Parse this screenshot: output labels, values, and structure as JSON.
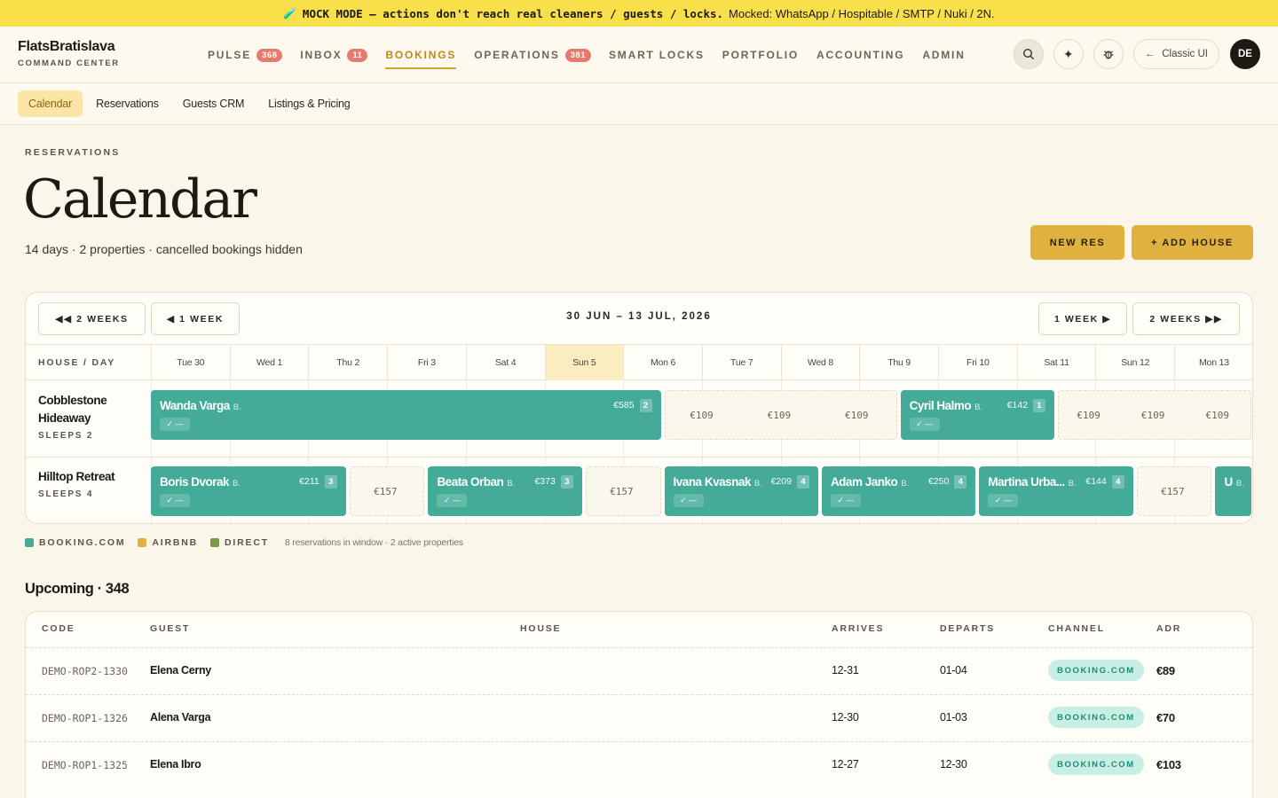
{
  "banner": {
    "icon": "test-tube-icon",
    "strong": "MOCK MODE — actions don't reach real cleaners / guests / locks.",
    "rest": "Mocked: WhatsApp / Hospitable / SMTP / Nuki / 2N."
  },
  "brand": {
    "name": "FlatsBratislava",
    "sub": "COMMAND CENTER"
  },
  "nav": [
    {
      "label": "PULSE",
      "count": "368"
    },
    {
      "label": "INBOX",
      "count": "11"
    },
    {
      "label": "BOOKINGS",
      "count": ""
    },
    {
      "label": "OPERATIONS",
      "count": "381"
    },
    {
      "label": "SMART LOCKS",
      "count": ""
    },
    {
      "label": "PORTFOLIO",
      "count": ""
    },
    {
      "label": "ACCOUNTING",
      "count": ""
    },
    {
      "label": "ADMIN",
      "count": ""
    }
  ],
  "nav_active": "BOOKINGS",
  "topright": {
    "classic_label": "Classic UI",
    "avatar": "DE"
  },
  "subnav": [
    "Calendar",
    "Reservations",
    "Guests CRM",
    "Listings & Pricing"
  ],
  "page": {
    "eyebrow": "RESERVATIONS",
    "title": "Calendar",
    "subtitle": "14 days · 2 properties · cancelled bookings hidden",
    "new_res": "NEW RES",
    "add_house": "+ ADD HOUSE"
  },
  "calendar": {
    "prev2": "◀◀ 2 WEEKS",
    "prev1": "◀ 1 WEEK",
    "range": "30 JUN – 13 JUL, 2026",
    "next1": "1 WEEK ▶",
    "next2": "2 WEEKS ▶▶",
    "house_day": "HOUSE / DAY",
    "days": [
      "Tue 30",
      "Wed 1",
      "Thu 2",
      "Fri 3",
      "Sat 4",
      "Sun 5",
      "Mon 6",
      "Tue 7",
      "Wed 8",
      "Thu 9",
      "Fri 10",
      "Sat 11",
      "Sun 12",
      "Mon 13"
    ],
    "today_index": 5,
    "houses": [
      {
        "name": "Cobblestone Hideaway",
        "sleeps": "SLEEPS 2",
        "bookings": [
          {
            "guest": "Wanda Varga",
            "ch": "B.",
            "price": "€585",
            "nights": "2",
            "start": 0,
            "end": 6.5
          },
          {
            "guest": "Cyril Halmo",
            "ch": "B.",
            "price": "€142",
            "nights": "1",
            "start": 9.5,
            "end": 11.5
          }
        ],
        "slots": [
          {
            "start": 6.5,
            "end": 9.5,
            "prices": [
              "€109",
              "€109",
              "€109"
            ]
          },
          {
            "start": 11.5,
            "end": 14,
            "prices": [
              "€109",
              "€109",
              "€109"
            ]
          }
        ]
      },
      {
        "name": "Hilltop Retreat",
        "sleeps": "SLEEPS 4",
        "bookings": [
          {
            "guest": "Boris Dvorak",
            "ch": "B.",
            "price": "€211",
            "nights": "3",
            "start": 0,
            "end": 2.5
          },
          {
            "guest": "Beata Orban",
            "ch": "B.",
            "price": "€373",
            "nights": "3",
            "start": 3.5,
            "end": 5.5
          },
          {
            "guest": "Ivana Kvasnak",
            "ch": "B.",
            "price": "€209",
            "nights": "4",
            "start": 6.5,
            "end": 8.5
          },
          {
            "guest": "Adam Janko",
            "ch": "B.",
            "price": "€250",
            "nights": "4",
            "start": 8.5,
            "end": 10.5
          },
          {
            "guest": "Martina Urba...",
            "ch": "B.",
            "price": "€144",
            "nights": "4",
            "start": 10.5,
            "end": 12.5
          },
          {
            "guest": "U",
            "ch": "B.",
            "price": "",
            "nights": "",
            "start": 13.5,
            "end": 14
          }
        ],
        "slots": [
          {
            "start": 2.5,
            "end": 3.5,
            "prices": [
              "€157"
            ]
          },
          {
            "start": 5.5,
            "end": 6.5,
            "prices": [
              "€157"
            ]
          },
          {
            "start": 12.5,
            "end": 13.5,
            "prices": [
              "€157"
            ]
          }
        ]
      }
    ],
    "chip_text": "✓ —"
  },
  "legend": {
    "items": [
      {
        "label": "BOOKING.COM",
        "color": "#43ab97"
      },
      {
        "label": "AIRBNB",
        "color": "#e0b13e"
      },
      {
        "label": "DIRECT",
        "color": "#7a9a4a"
      }
    ],
    "note": "8 reservations in window · 2 active properties"
  },
  "upcoming": {
    "title": "Upcoming · 348",
    "columns": [
      "CODE",
      "GUEST",
      "HOUSE",
      "ARRIVES",
      "DEPARTS",
      "CHANNEL",
      "ADR"
    ],
    "rows": [
      {
        "code": "DEMO-ROP2-1330",
        "guest": "Elena Cerny",
        "house": "",
        "arrives": "12-31",
        "departs": "01-04",
        "channel": "BOOKING.COM",
        "adr": "€89"
      },
      {
        "code": "DEMO-ROP1-1326",
        "guest": "Alena Varga",
        "house": "",
        "arrives": "12-30",
        "departs": "01-03",
        "channel": "BOOKING.COM",
        "adr": "€70"
      },
      {
        "code": "DEMO-ROP1-1325",
        "guest": "Elena Ibro",
        "house": "",
        "arrives": "12-27",
        "departs": "12-30",
        "channel": "BOOKING.COM",
        "adr": "€103"
      }
    ]
  }
}
